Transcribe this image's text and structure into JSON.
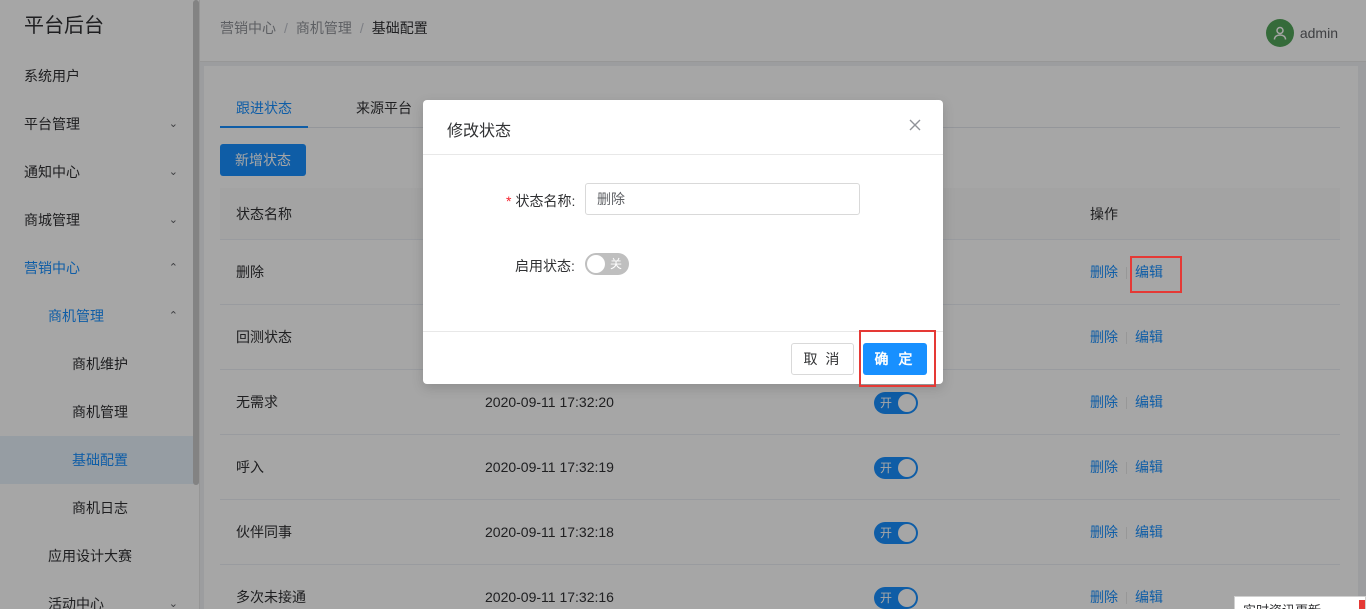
{
  "sidebar": {
    "brand": "平台后台",
    "items": [
      {
        "label": "系统用户",
        "chev": ""
      },
      {
        "label": "平台管理",
        "chev": "⌄"
      },
      {
        "label": "通知中心",
        "chev": "⌄"
      },
      {
        "label": "商城管理",
        "chev": "⌄"
      },
      {
        "label": "营销中心",
        "chev": "⌃"
      },
      {
        "label": "商机管理",
        "chev": "⌃"
      },
      {
        "label": "商机维护",
        "chev": ""
      },
      {
        "label": "商机管理",
        "chev": ""
      },
      {
        "label": "基础配置",
        "chev": ""
      },
      {
        "label": "商机日志",
        "chev": ""
      },
      {
        "label": "应用设计大赛",
        "chev": ""
      },
      {
        "label": "活动中心",
        "chev": "⌄"
      }
    ]
  },
  "header": {
    "breadcrumb": [
      "营销中心",
      "商机管理",
      "基础配置"
    ],
    "separator": "/",
    "user": "admin"
  },
  "content": {
    "tabs": [
      "跟进状态",
      "来源平台"
    ],
    "add_button": "新增状态",
    "columns": {
      "name": "状态名称",
      "ops": "操作"
    },
    "rows": [
      {
        "name": "删除",
        "time": "",
        "switch": "",
        "del": "删除",
        "edit": "编辑"
      },
      {
        "name": "回测状态",
        "time": "",
        "switch": "",
        "del": "删除",
        "edit": "编辑"
      },
      {
        "name": "无需求",
        "time": "2020-09-11 17:32:20",
        "switch": "开",
        "del": "删除",
        "edit": "编辑"
      },
      {
        "name": "呼入",
        "time": "2020-09-11 17:32:19",
        "switch": "开",
        "del": "删除",
        "edit": "编辑"
      },
      {
        "name": "伙伴同事",
        "time": "2020-09-11 17:32:18",
        "switch": "开",
        "del": "删除",
        "edit": "编辑"
      },
      {
        "name": "多次未接通",
        "time": "2020-09-11 17:32:16",
        "switch": "开",
        "del": "删除",
        "edit": "编辑"
      }
    ]
  },
  "dialog": {
    "title": "修改状态",
    "required_mark": "*",
    "name_label": "状态名称:",
    "name_value": "删除",
    "enable_label": "启用状态:",
    "enable_switch": "关",
    "cancel": "取 消",
    "ok": "确 定"
  },
  "notify": {
    "text": "实时资讯更新"
  },
  "colors": {
    "accent": "#1890ff",
    "highlight": "#e53935"
  }
}
